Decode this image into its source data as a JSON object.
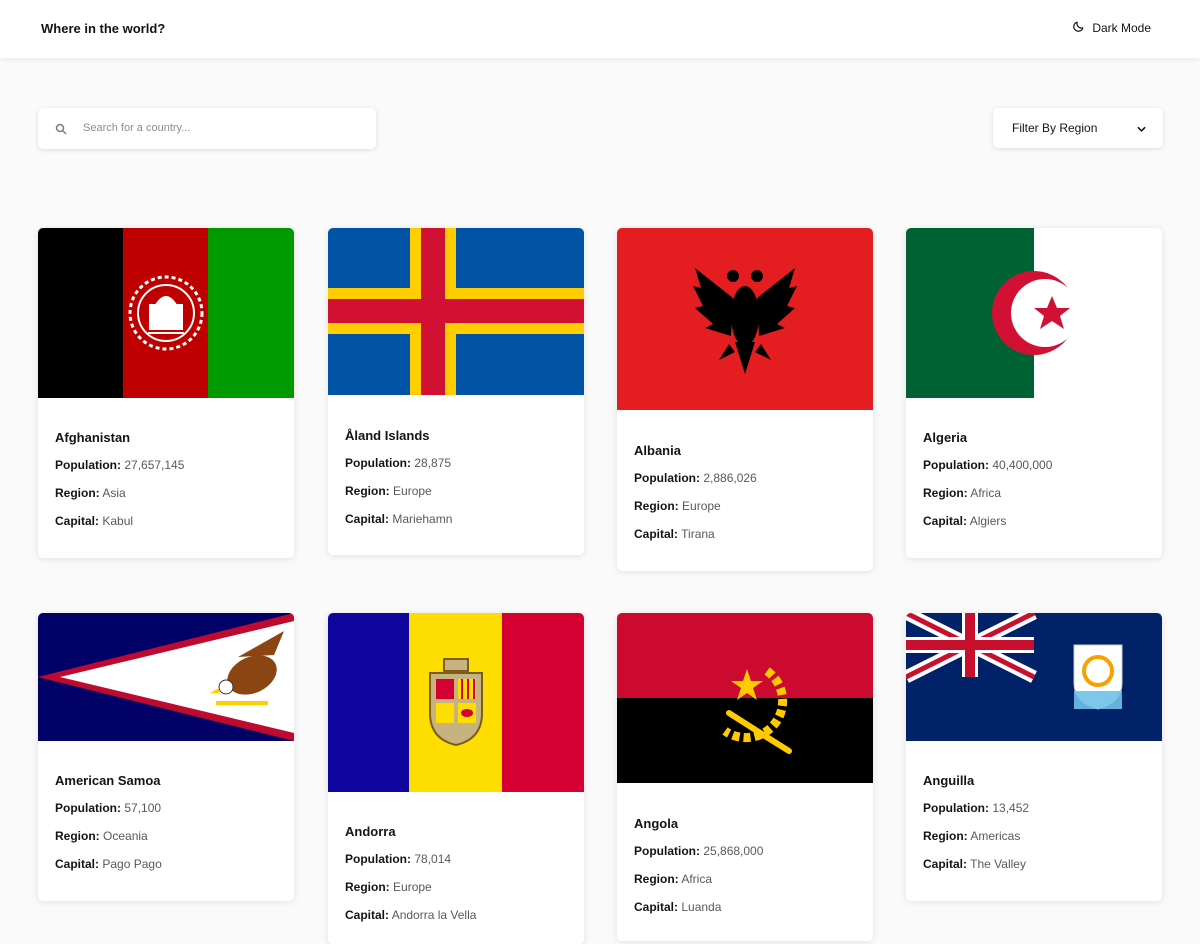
{
  "header": {
    "title": "Where in the world?",
    "mode_label": "Dark Mode",
    "mode_icon": "moon-icon"
  },
  "search": {
    "placeholder": "Search for a country...",
    "value": "",
    "icon": "search-icon"
  },
  "filter": {
    "label": "Filter By Region",
    "icon": "chevron-down-icon"
  },
  "labels": {
    "population": "Population:",
    "region": "Region:",
    "capital": "Capital:"
  },
  "countries": [
    {
      "name": "Afghanistan",
      "population": "27,657,145",
      "region": "Asia",
      "capital": "Kabul",
      "flag": "afghanistan-flag"
    },
    {
      "name": "Åland Islands",
      "population": "28,875",
      "region": "Europe",
      "capital": "Mariehamn",
      "flag": "aland-islands-flag"
    },
    {
      "name": "Albania",
      "population": "2,886,026",
      "region": "Europe",
      "capital": "Tirana",
      "flag": "albania-flag"
    },
    {
      "name": "Algeria",
      "population": "40,400,000",
      "region": "Africa",
      "capital": "Algiers",
      "flag": "algeria-flag"
    },
    {
      "name": "American Samoa",
      "population": "57,100",
      "region": "Oceania",
      "capital": "Pago Pago",
      "flag": "american-samoa-flag"
    },
    {
      "name": "Andorra",
      "population": "78,014",
      "region": "Europe",
      "capital": "Andorra la Vella",
      "flag": "andorra-flag"
    },
    {
      "name": "Angola",
      "population": "25,868,000",
      "region": "Africa",
      "capital": "Luanda",
      "flag": "angola-flag"
    },
    {
      "name": "Anguilla",
      "population": "13,452",
      "region": "Americas",
      "capital": "The Valley",
      "flag": "anguilla-flag"
    }
  ]
}
